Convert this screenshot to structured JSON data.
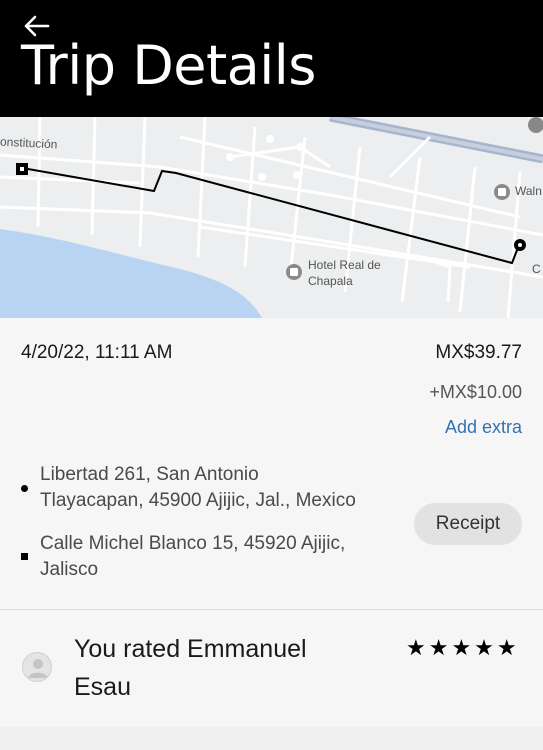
{
  "header": {
    "title": "Trip Details",
    "back_icon": "arrow-left-icon"
  },
  "map": {
    "street_label": "onstitución",
    "hotel_label_line1": "Hotel Real de",
    "hotel_label_line2": "Chapala",
    "store_label": "Waln",
    "edge_label": "C",
    "colors": {
      "water": "#b9d4f2",
      "road": "#ffffff",
      "highway": "#a7b4cc",
      "route": "#000000"
    }
  },
  "trip": {
    "datetime": "4/20/22, 11:11 AM",
    "fare": "MX$39.77",
    "tip": "+MX$10.00",
    "add_extra_label": "Add extra",
    "pickup_line1": "Libertad 261, San Antonio",
    "pickup_line2": "Tlayacapan, 45900 Ajijic, Jal., Mexico",
    "dropoff_line1": "Calle Michel Blanco 15, 45920 Ajijic,",
    "dropoff_line2": "Jalisco",
    "receipt_label": "Receipt"
  },
  "rating": {
    "text_line1": "You rated Emmanuel",
    "text_line2": "Esau",
    "stars": "★★★★★",
    "stars_count": 5
  }
}
